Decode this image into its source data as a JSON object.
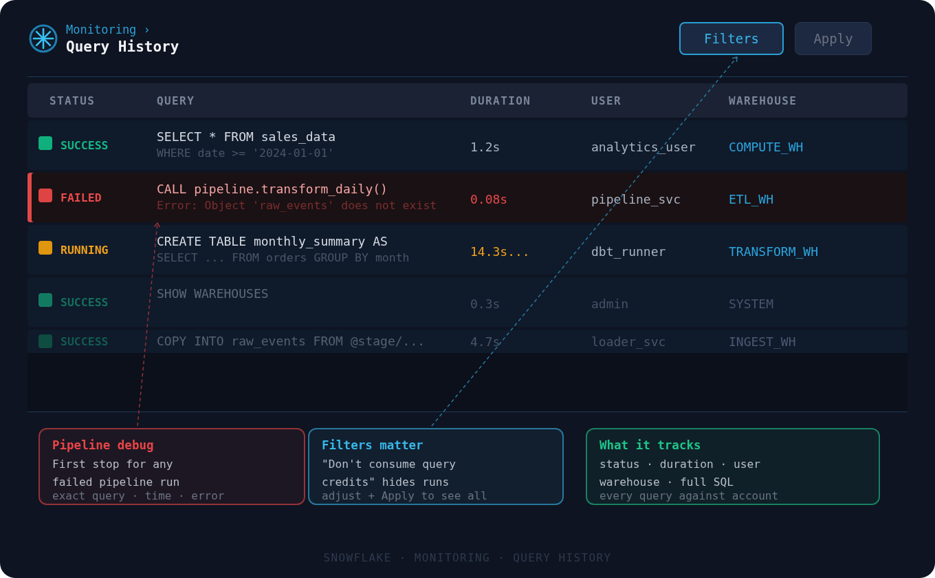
{
  "header": {
    "breadcrumb": "Monitoring ›",
    "title": "Query History"
  },
  "actions": [
    {
      "label": "Filters",
      "disabled": false
    },
    {
      "label": "Apply",
      "disabled": true
    }
  ],
  "table": {
    "columns": [
      "STATUS",
      "QUERY",
      "DURATION",
      "USER",
      "WAREHOUSE"
    ],
    "rows": [
      {
        "kind": "success",
        "color": "#10b07c",
        "status": "SUCCESS",
        "query": "SELECT * FROM sales_data",
        "detail": "WHERE date >= '2024-01-01'",
        "duration": "1.2s",
        "user": "analytics_user",
        "warehouse": "COMPUTE_WH",
        "dimmed": false
      },
      {
        "kind": "failed",
        "color": "#de4444",
        "status": "FAILED",
        "query": "CALL pipeline.transform_daily()",
        "detail": "Error: Object 'raw_events' does not exist",
        "duration": "0.08s",
        "user": "pipeline_svc",
        "warehouse": "ETL_WH",
        "dimmed": false
      },
      {
        "kind": "running",
        "color": "#e0960f",
        "status": "RUNNING",
        "query": "CREATE TABLE monthly_summary AS",
        "detail": "SELECT ... FROM orders GROUP BY month",
        "duration": "14.3s...",
        "user": "dbt_runner",
        "warehouse": "TRANSFORM_WH",
        "dimmed": false
      },
      {
        "kind": "success",
        "color": "#137a62",
        "status": "SUCCESS",
        "query": "SHOW WAREHOUSES",
        "duration": "0.3s",
        "user": "admin",
        "warehouse": "SYSTEM",
        "dimmed": true
      },
      {
        "kind": "success",
        "color": "#0f4d40",
        "status": "SUCCESS",
        "query": "COPY INTO raw_events FROM @stage/...",
        "duration": "4.7s",
        "user": "loader_svc",
        "warehouse": "INGEST_WH",
        "dimmed": true
      }
    ]
  },
  "callouts": [
    {
      "title": "Pipeline debug",
      "body": "First stop for any\nfailed pipeline run",
      "note": "exact query · time · error",
      "color": "#e84545",
      "leader": true
    },
    {
      "title": "Filters matter",
      "body": "\"Don't consume query\ncredits\" hides runs",
      "note": "adjust + Apply to see all",
      "color": "#38b6e8",
      "leader": true
    },
    {
      "title": "What it tracks",
      "body": "status · duration · user\nwarehouse · full SQL",
      "note": "every query against account",
      "color": "#1fc48a",
      "leader": false
    }
  ],
  "footer": "SNOWFLAKE · MONITORING · QUERY HISTORY"
}
